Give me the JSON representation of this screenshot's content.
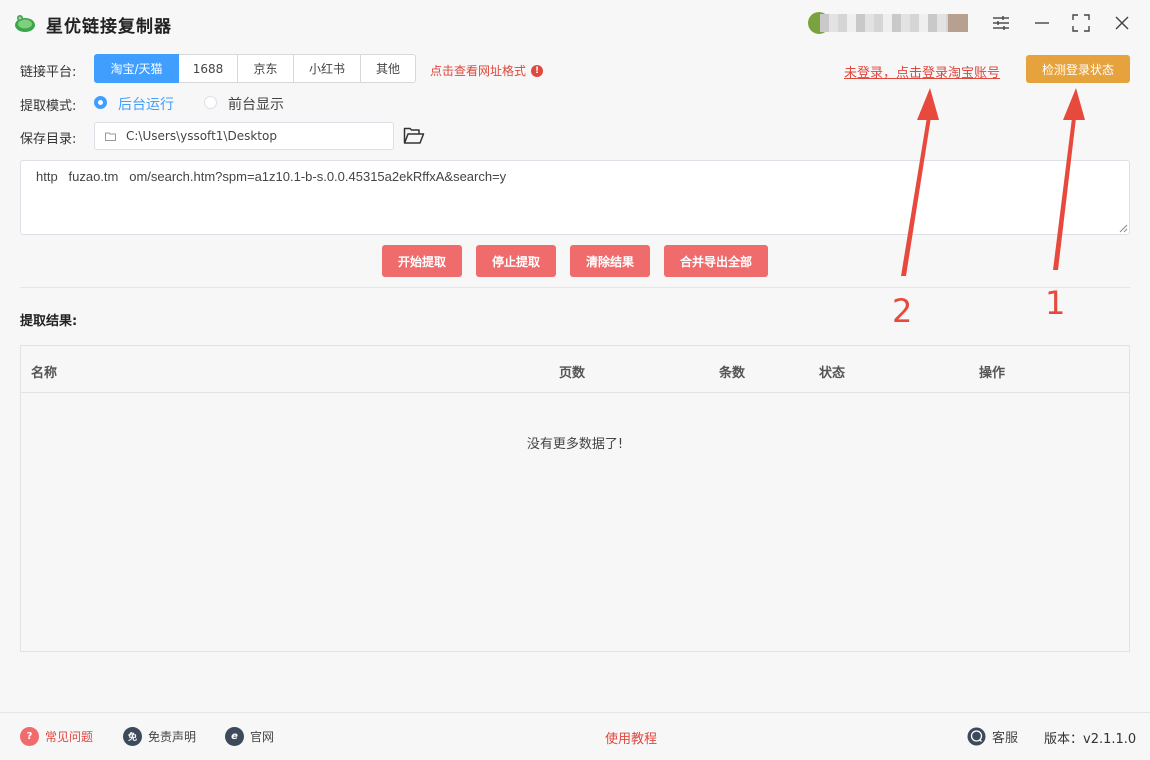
{
  "window": {
    "title": "星优链接复制器"
  },
  "platform": {
    "label": "链接平台:",
    "tabs": [
      "淘宝/天猫",
      "1688",
      "京东",
      "小红书",
      "其他"
    ],
    "active_index": 0,
    "url_format_link": "点击查看网址格式",
    "info_glyph": "!"
  },
  "login": {
    "link_text": "未登录，点击登录淘宝账号",
    "check_button": "检测登录状态"
  },
  "mode": {
    "label": "提取模式:",
    "options": [
      "后台运行",
      "前台显示"
    ],
    "selected_index": 0
  },
  "save_dir": {
    "label": "保存目录:",
    "path": "C:\\Users\\yssoft1\\Desktop"
  },
  "url_input": {
    "value": "http   fuzao.tm   om/search.htm?spm=a1z10.1-b-s.0.0.45315a2ekRffxA&search=y"
  },
  "actions": {
    "start": "开始提取",
    "stop": "停止提取",
    "clear": "清除结果",
    "export_all": "合并导出全部"
  },
  "results": {
    "title": "提取结果:",
    "columns": [
      "名称",
      "页数",
      "条数",
      "状态",
      "操作"
    ],
    "empty_message": "没有更多数据了!"
  },
  "footer": {
    "faq": "常见问题",
    "disclaimer": "免责声明",
    "disclaimer_glyph": "免",
    "website": "官网",
    "website_glyph": "e",
    "faq_glyph": "?",
    "tutorial": "使用教程",
    "support": "客服",
    "version": "版本：v2.1.1.0"
  },
  "annotations": {
    "marker_1": "1",
    "marker_2": "2"
  },
  "colors": {
    "primary_blue": "#409eff",
    "accent_orange": "#e6a23c",
    "action_red": "#f06b6b",
    "link_red": "#e0473d",
    "annotation_red": "#e8493d"
  }
}
